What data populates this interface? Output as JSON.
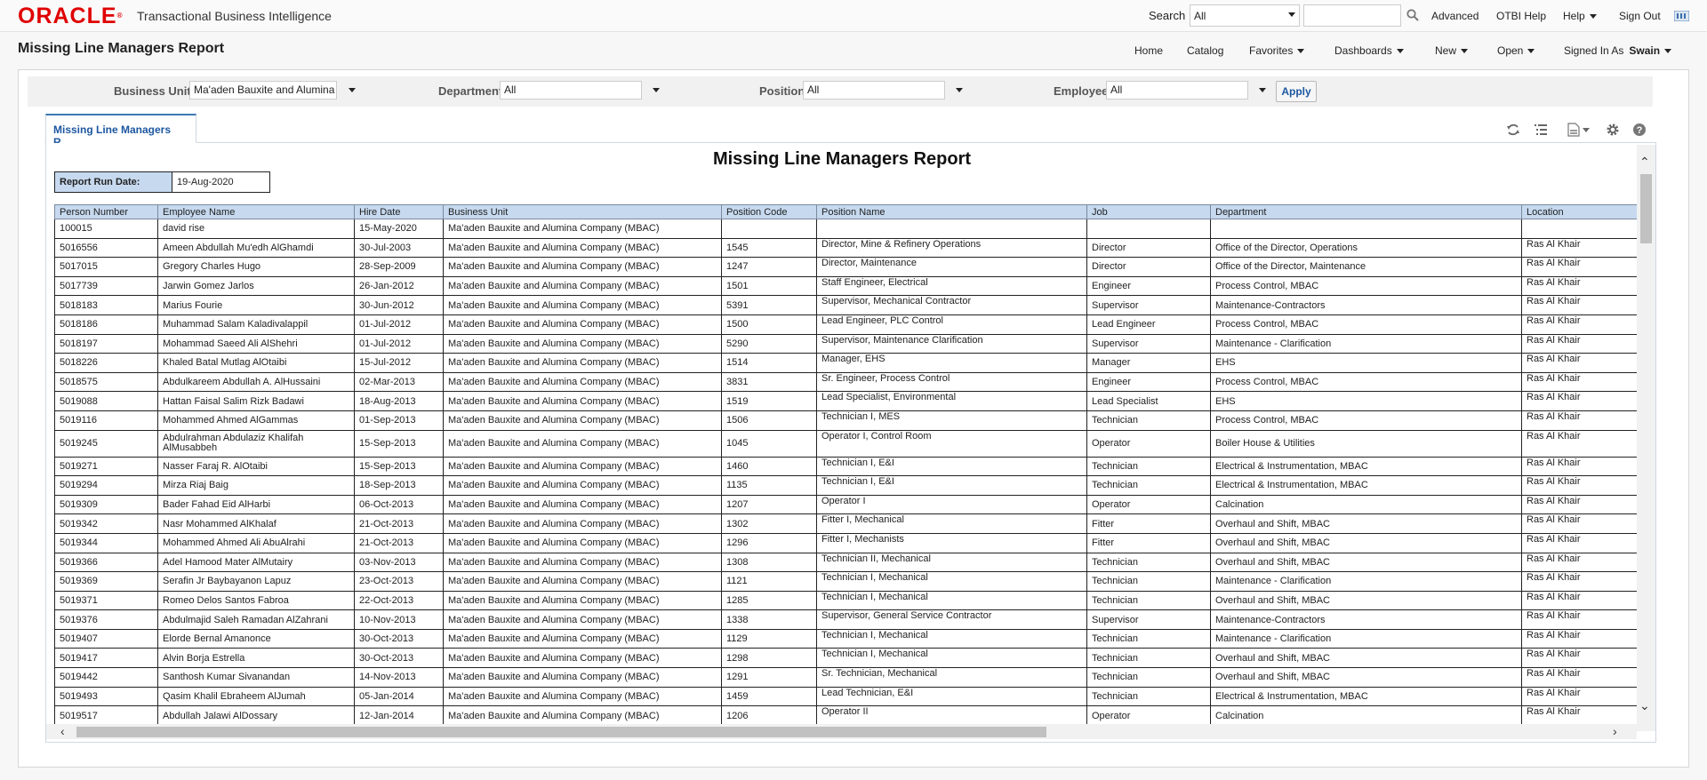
{
  "app": {
    "logo": "ORACLE",
    "name": "Transactional Business Intelligence"
  },
  "topbar": {
    "search_label": "Search",
    "search_scope": "All",
    "advanced": "Advanced",
    "otbi_help": "OTBI Help",
    "help": "Help",
    "sign_out": "Sign Out"
  },
  "page": {
    "title": "Missing Line Managers Report"
  },
  "nav": {
    "home": "Home",
    "catalog": "Catalog",
    "favorites": "Favorites",
    "dashboards": "Dashboards",
    "new": "New",
    "open": "Open",
    "signed_in_as": "Signed In As",
    "user": "Swain"
  },
  "prompts": {
    "business_unit_label": "Business Unit",
    "business_unit_value": "Ma'aden Bauxite and Alumina",
    "department_label": "Department",
    "department_value": "All",
    "position_label": "Position",
    "position_value": "All",
    "employee_label": "Employee",
    "employee_value": "All",
    "apply": "Apply"
  },
  "tab": {
    "label": "Missing Line Managers R..."
  },
  "report": {
    "title": "Missing Line Managers Report",
    "run_date_label": "Report Run Date:",
    "run_date": "19-Aug-2020",
    "columns": [
      "Person Number",
      "Employee Name",
      "Hire Date",
      "Business Unit",
      "Position Code",
      "Position Name",
      "Job",
      "Department",
      "Location"
    ],
    "rows": [
      [
        "100015",
        "david rise",
        "15-May-2020",
        "Ma'aden Bauxite and Alumina Company (MBAC)",
        "",
        "",
        "",
        "",
        ""
      ],
      [
        "5016556",
        "Ameen Abdullah Mu'edh AlGhamdi",
        "30-Jul-2003",
        "Ma'aden Bauxite and Alumina Company (MBAC)",
        "1545",
        "Director, Mine & Refinery Operations",
        "Director",
        "Office of the Director, Operations",
        "Ras Al Khair"
      ],
      [
        "5017015",
        "Gregory Charles Hugo",
        "28-Sep-2009",
        "Ma'aden Bauxite and Alumina Company (MBAC)",
        "1247",
        "Director, Maintenance",
        "Director",
        "Office of the Director, Maintenance",
        "Ras Al Khair"
      ],
      [
        "5017739",
        "Jarwin Gomez Jarlos",
        "26-Jan-2012",
        "Ma'aden Bauxite and Alumina Company (MBAC)",
        "1501",
        "Staff Engineer, Electrical",
        "Engineer",
        "Process Control, MBAC",
        "Ras Al Khair"
      ],
      [
        "5018183",
        "Marius Fourie",
        "30-Jun-2012",
        "Ma'aden Bauxite and Alumina Company (MBAC)",
        "5391",
        "Supervisor, Mechanical Contractor",
        "Supervisor",
        "Maintenance-Contractors",
        "Ras Al Khair"
      ],
      [
        "5018186",
        "Muhammad Salam Kaladivalappil",
        "01-Jul-2012",
        "Ma'aden Bauxite and Alumina Company (MBAC)",
        "1500",
        "Lead Engineer, PLC Control",
        "Lead Engineer",
        "Process Control, MBAC",
        "Ras Al Khair"
      ],
      [
        "5018197",
        "Mohammad Saeed Ali AlShehri",
        "01-Jul-2012",
        "Ma'aden Bauxite and Alumina Company (MBAC)",
        "5290",
        "Supervisor, Maintenance Clarification",
        "Supervisor",
        "Maintenance - Clarification",
        "Ras Al Khair"
      ],
      [
        "5018226",
        "Khaled Batal Mutlag AlOtaibi",
        "15-Jul-2012",
        "Ma'aden Bauxite and Alumina Company (MBAC)",
        "1514",
        "Manager, EHS",
        "Manager",
        "EHS",
        "Ras Al Khair"
      ],
      [
        "5018575",
        "Abdulkareem Abdullah A. AlHussaini",
        "02-Mar-2013",
        "Ma'aden Bauxite and Alumina Company (MBAC)",
        "3831",
        "Sr. Engineer, Process Control",
        "Engineer",
        "Process Control, MBAC",
        "Ras Al Khair"
      ],
      [
        "5019088",
        "Hattan Faisal Salim Rizk Badawi",
        "18-Aug-2013",
        "Ma'aden Bauxite and Alumina Company (MBAC)",
        "1519",
        "Lead Specialist, Environmental",
        "Lead Specialist",
        "EHS",
        "Ras Al Khair"
      ],
      [
        "5019116",
        "Mohammed Ahmed AlGammas",
        "01-Sep-2013",
        "Ma'aden Bauxite and Alumina Company (MBAC)",
        "1506",
        "Technician I, MES",
        "Technician",
        "Process Control, MBAC",
        "Ras Al Khair"
      ],
      [
        "5019245",
        "Abdulrahman Abdulaziz Khalifah AlMusabbeh",
        "15-Sep-2013",
        "Ma'aden Bauxite and Alumina Company (MBAC)",
        "1045",
        "Operator I, Control Room",
        "Operator",
        "Boiler House & Utilities",
        "Ras Al Khair"
      ],
      [
        "5019271",
        "Nasser Faraj R. AlOtaibi",
        "15-Sep-2013",
        "Ma'aden Bauxite and Alumina Company (MBAC)",
        "1460",
        "Technician I, E&I",
        "Technician",
        "Electrical & Instrumentation, MBAC",
        "Ras Al Khair"
      ],
      [
        "5019294",
        "Mirza Riaj Baig",
        "18-Sep-2013",
        "Ma'aden Bauxite and Alumina Company (MBAC)",
        "1135",
        "Technician I, E&I",
        "Technician",
        "Electrical & Instrumentation, MBAC",
        "Ras Al Khair"
      ],
      [
        "5019309",
        "Bader Fahad Eid AlHarbi",
        "06-Oct-2013",
        "Ma'aden Bauxite and Alumina Company (MBAC)",
        "1207",
        "Operator I",
        "Operator",
        "Calcination",
        "Ras Al Khair"
      ],
      [
        "5019342",
        "Nasr Mohammed AlKhalaf",
        "21-Oct-2013",
        "Ma'aden Bauxite and Alumina Company (MBAC)",
        "1302",
        "Fitter I, Mechanical",
        "Fitter",
        "Overhaul and Shift, MBAC",
        "Ras Al Khair"
      ],
      [
        "5019344",
        "Mohammed Ahmed Ali AbuAlrahi",
        "21-Oct-2013",
        "Ma'aden Bauxite and Alumina Company (MBAC)",
        "1296",
        "Fitter I,  Mechanists",
        "Fitter",
        "Overhaul and Shift, MBAC",
        "Ras Al Khair"
      ],
      [
        "5019366",
        "Adel Hamood Mater AlMutairy",
        "03-Nov-2013",
        "Ma'aden Bauxite and Alumina Company (MBAC)",
        "1308",
        "Technician II, Mechanical",
        "Technician",
        "Overhaul and Shift, MBAC",
        "Ras Al Khair"
      ],
      [
        "5019369",
        "Serafin Jr Baybayanon Lapuz",
        "23-Oct-2013",
        "Ma'aden Bauxite and Alumina Company (MBAC)",
        "1121",
        "Technician I, Mechanical",
        "Technician",
        "Maintenance - Clarification",
        "Ras Al Khair"
      ],
      [
        "5019371",
        "Romeo Delos Santos Fabroa",
        "22-Oct-2013",
        "Ma'aden Bauxite and Alumina Company (MBAC)",
        "1285",
        "Technician I, Mechanical",
        "Technician",
        "Overhaul and Shift, MBAC",
        "Ras Al Khair"
      ],
      [
        "5019376",
        "Abdulmajid Saleh Ramadan AlZahrani",
        "10-Nov-2013",
        "Ma'aden Bauxite and Alumina Company (MBAC)",
        "1338",
        "Supervisor, General Service Contractor",
        "Supervisor",
        "Maintenance-Contractors",
        "Ras Al Khair"
      ],
      [
        "5019407",
        "Elorde Bernal Amanonce",
        "30-Oct-2013",
        "Ma'aden Bauxite and Alumina Company (MBAC)",
        "1129",
        "Technician I, Mechanical",
        "Technician",
        "Maintenance - Clarification",
        "Ras Al Khair"
      ],
      [
        "5019417",
        "Alvin Borja Estrella",
        "30-Oct-2013",
        "Ma'aden Bauxite and Alumina Company (MBAC)",
        "1298",
        "Technician I, Mechanical",
        "Technician",
        "Overhaul and Shift, MBAC",
        "Ras Al Khair"
      ],
      [
        "5019442",
        "Santhosh Kumar Sivanandan",
        "14-Nov-2013",
        "Ma'aden Bauxite and Alumina Company (MBAC)",
        "1291",
        "Sr. Technician, Mechanical",
        "Technician",
        "Overhaul and Shift, MBAC",
        "Ras Al Khair"
      ],
      [
        "5019493",
        "Qasim Khalil Ebraheem AlJumah",
        "05-Jan-2014",
        "Ma'aden Bauxite and Alumina Company (MBAC)",
        "1459",
        "Lead Technician, E&I",
        "Technician",
        "Electrical & Instrumentation, MBAC",
        "Ras Al Khair"
      ],
      [
        "5019517",
        "Abdullah Jalawi AlDossary",
        "12-Jan-2014",
        "Ma'aden Bauxite and Alumina Company (MBAC)",
        "1206",
        "Operator II",
        "Operator",
        "Calcination",
        "Ras Al Khair"
      ]
    ]
  },
  "colors": {
    "oracle_red": "#e00000",
    "header_blue": "#c6d9ef",
    "link_blue": "#1d57a0"
  }
}
